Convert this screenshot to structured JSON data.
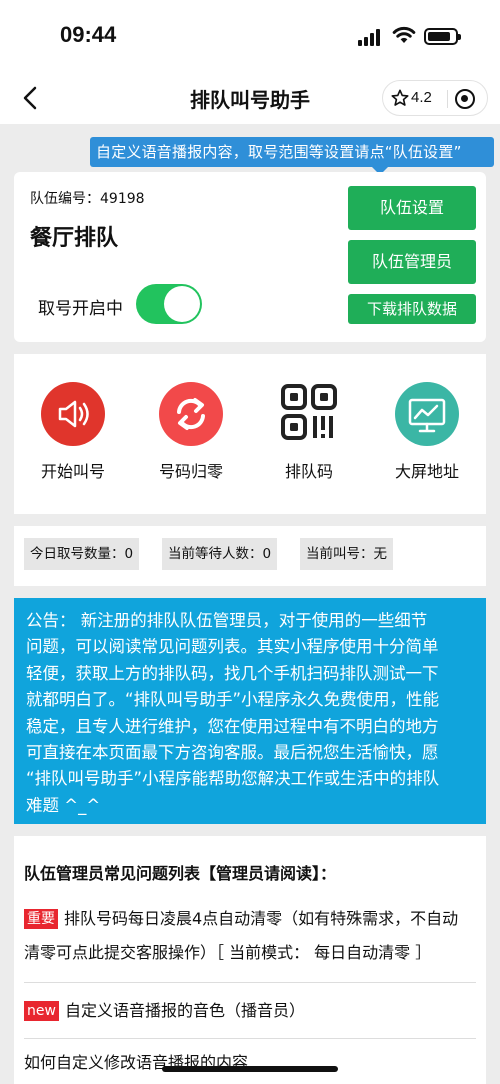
{
  "status_bar": {
    "time": "09:44"
  },
  "nav": {
    "title": "排队叫号助手",
    "rating": "4.2"
  },
  "tip": {
    "text": "自定义语音播报内容，取号范围等设置请点“队伍设置”"
  },
  "team": {
    "id_label": "队伍编号：49198",
    "name": "餐厅排队",
    "toggle_label": "取号开启中",
    "toggle_on": true,
    "buttons": {
      "settings": "队伍设置",
      "admin": "队伍管理员",
      "download": "下载排队数据"
    }
  },
  "functions": [
    {
      "label": "开始叫号",
      "icon": "speaker-icon",
      "color": "#e0352c"
    },
    {
      "label": "号码归零",
      "icon": "refresh-icon",
      "color": "#f2494a"
    },
    {
      "label": "排队码",
      "icon": "qrcode-icon",
      "color": "#222222"
    },
    {
      "label": "大屏地址",
      "icon": "monitor-icon",
      "color": "#3bb6a5"
    }
  ],
  "stats": {
    "today": "今日取号数量：0",
    "waiting": "当前等待人数：0",
    "calling": "当前叫号：无"
  },
  "notice": {
    "lines": [
      "公告： 新注册的排队队伍管理员，对于使用的一些细节",
      "问题，可以阅读常见问题列表。其实小程序使用十分简单",
      "轻便，获取上方的排队码，找几个手机扫码排队测试一下",
      "就都明白了。“排队叫号助手”小程序永久免费使用，性能",
      "稳定，且专人进行维护，您在使用过程中有不明白的地方",
      "可直接在本页面最下方咨询客服。最后祝您生活愉快，愿",
      "“排队叫号助手”小程序能帮助您解决工作或生活中的排队",
      "难题 ^_^"
    ]
  },
  "faq": {
    "title": "队伍管理员常见问题列表【管理员请阅读】：",
    "items": [
      {
        "tag": "重要",
        "line1": "排队号码每日凌晨4点自动清零（如有特殊需求，不自动",
        "line2": "清零可点此提交客服操作）［ 当前模式： 每日自动清零 ］"
      },
      {
        "tag": "new",
        "line1": "自定义语音播报的音色（播音员）"
      },
      {
        "line1": "如何自定义修改语音播报的内容"
      }
    ]
  }
}
